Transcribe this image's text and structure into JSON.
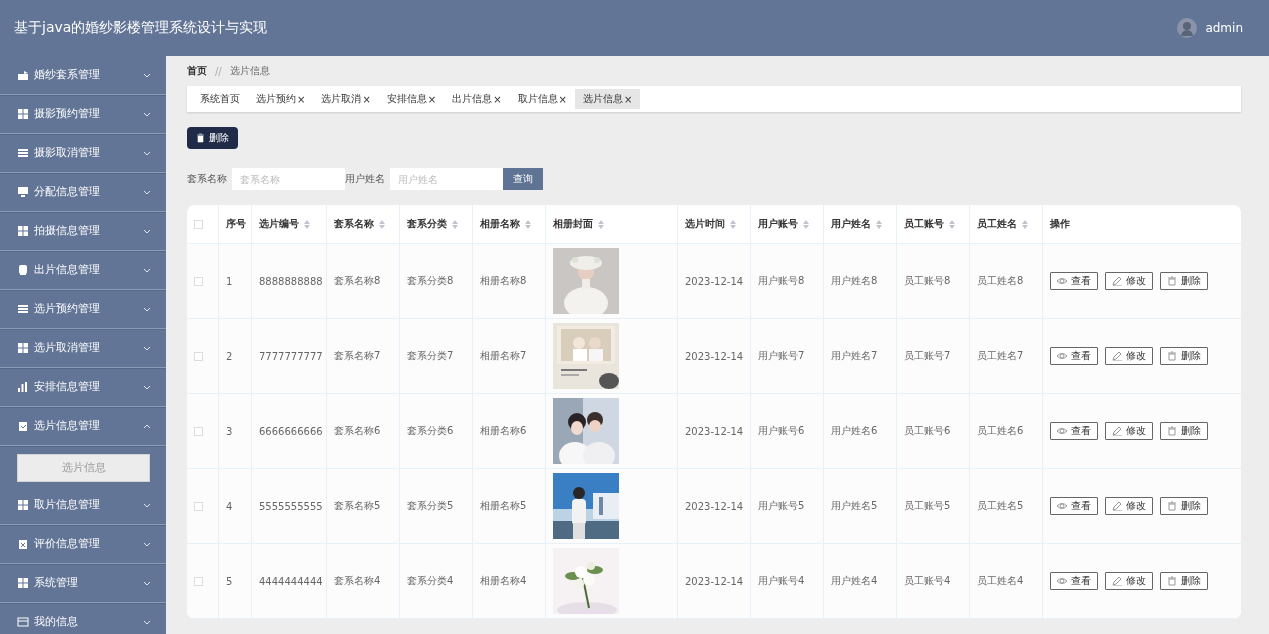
{
  "header": {
    "title": "基于java的婚纱影楼管理系统设计与实现",
    "user": "admin"
  },
  "sidebar": {
    "items": [
      {
        "label": "婚纱套系管理",
        "expanded": false
      },
      {
        "label": "摄影预约管理",
        "expanded": false
      },
      {
        "label": "摄影取消管理",
        "expanded": false
      },
      {
        "label": "分配信息管理",
        "expanded": false
      },
      {
        "label": "拍摄信息管理",
        "expanded": false
      },
      {
        "label": "出片信息管理",
        "expanded": false
      },
      {
        "label": "选片预约管理",
        "expanded": false
      },
      {
        "label": "选片取消管理",
        "expanded": false
      },
      {
        "label": "安排信息管理",
        "expanded": false
      },
      {
        "label": "选片信息管理",
        "expanded": true,
        "children": [
          {
            "label": "选片信息",
            "selected": true
          }
        ]
      },
      {
        "label": "取片信息管理",
        "expanded": false
      },
      {
        "label": "评价信息管理",
        "expanded": false
      },
      {
        "label": "系统管理",
        "expanded": false
      },
      {
        "label": "我的信息",
        "expanded": false
      }
    ]
  },
  "breadcrumb": {
    "home": "首页",
    "separator": "//",
    "current": "选片信息"
  },
  "tabs": [
    {
      "label": "系统首页",
      "selected": false
    },
    {
      "label": "选片预约",
      "close": "×",
      "selected": false
    },
    {
      "label": "选片取消",
      "close": "×",
      "selected": false
    },
    {
      "label": "安排信息",
      "close": "×",
      "selected": false
    },
    {
      "label": "出片信息",
      "close": "×",
      "selected": false
    },
    {
      "label": "取片信息",
      "close": "×",
      "selected": false
    },
    {
      "label": "选片信息",
      "close": "×",
      "selected": true
    }
  ],
  "toolbar": {
    "delete_button": "删除"
  },
  "search": {
    "fields": [
      {
        "label": "套系名称",
        "placeholder": "套系名称"
      },
      {
        "label": "用户姓名",
        "placeholder": "用户姓名"
      }
    ],
    "button": "查询"
  },
  "table": {
    "select_all_checked": false,
    "columns": [
      {
        "label": "序号",
        "sortable": false
      },
      {
        "label": "选片编号",
        "sortable": true
      },
      {
        "label": "套系名称",
        "sortable": true
      },
      {
        "label": "套系分类",
        "sortable": true
      },
      {
        "label": "相册名称",
        "sortable": true
      },
      {
        "label": "相册封面",
        "sortable": true
      },
      {
        "label": "选片时间",
        "sortable": true
      },
      {
        "label": "用户账号",
        "sortable": true
      },
      {
        "label": "用户姓名",
        "sortable": true
      },
      {
        "label": "员工账号",
        "sortable": true
      },
      {
        "label": "员工姓名",
        "sortable": true
      },
      {
        "label": "操作",
        "sortable": false
      }
    ],
    "rows": [
      {
        "checked": false,
        "cells": [
          "1",
          "8888888888",
          "套系名称8",
          "套系分类8",
          "相册名称8",
          {
            "kind": "picture"
          },
          "2023-12-14",
          "用户账号8",
          "用户姓名8",
          "员工账号8",
          "员工姓名8"
        ],
        "actions": [
          "查看",
          "修改",
          "删除"
        ]
      },
      {
        "checked": false,
        "cells": [
          "2",
          "7777777777",
          "套系名称7",
          "套系分类7",
          "相册名称7",
          {
            "kind": "picture"
          },
          "2023-12-14",
          "用户账号7",
          "用户姓名7",
          "员工账号7",
          "员工姓名7"
        ],
        "actions": [
          "查看",
          "修改",
          "删除"
        ]
      },
      {
        "checked": false,
        "cells": [
          "3",
          "6666666666",
          "套系名称6",
          "套系分类6",
          "相册名称6",
          {
            "kind": "picture"
          },
          "2023-12-14",
          "用户账号6",
          "用户姓名6",
          "员工账号6",
          "员工姓名6"
        ],
        "actions": [
          "查看",
          "修改",
          "删除"
        ]
      },
      {
        "checked": false,
        "cells": [
          "4",
          "5555555555",
          "套系名称5",
          "套系分类5",
          "相册名称5",
          {
            "kind": "picture"
          },
          "2023-12-14",
          "用户账号5",
          "用户姓名5",
          "员工账号5",
          "员工姓名5"
        ],
        "actions": [
          "查看",
          "修改",
          "删除"
        ]
      },
      {
        "checked": false,
        "cells": [
          "5",
          "4444444444",
          "套系名称4",
          "套系分类4",
          "相册名称4",
          {
            "kind": "picture"
          },
          "2023-12-14",
          "用户账号4",
          "用户姓名4",
          "员工账号4",
          "员工姓名4"
        ],
        "actions": [
          "查看",
          "修改",
          "删除"
        ]
      }
    ]
  }
}
